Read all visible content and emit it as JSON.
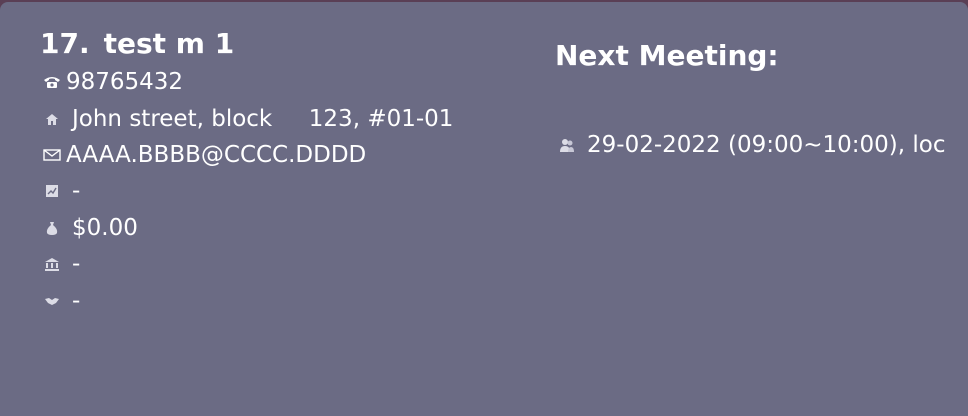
{
  "person": {
    "index": "17.",
    "name": "test m 1",
    "phone": "98765432",
    "address": "John street, block     123, #01-01",
    "email": "AAAA.BBBB@CCCC.DDDD",
    "field_chart": "-",
    "money": "$0.00",
    "field_bank": "-",
    "field_handshake": "-"
  },
  "meeting": {
    "heading": "Next Meeting:",
    "detail": "29-02-2022 (09:00~10:00), loc"
  },
  "icons": {
    "phone": "telephone-icon",
    "address": "house-icon",
    "email": "envelope-icon",
    "chart": "chart-icon",
    "money": "money-bag-icon",
    "bank": "bank-icon",
    "handshake": "handshake-icon",
    "meeting": "meeting-people-icon"
  },
  "colors": {
    "card_background": "#6b6b84",
    "window_background": "#5a3f55",
    "text": "#ffffff"
  }
}
